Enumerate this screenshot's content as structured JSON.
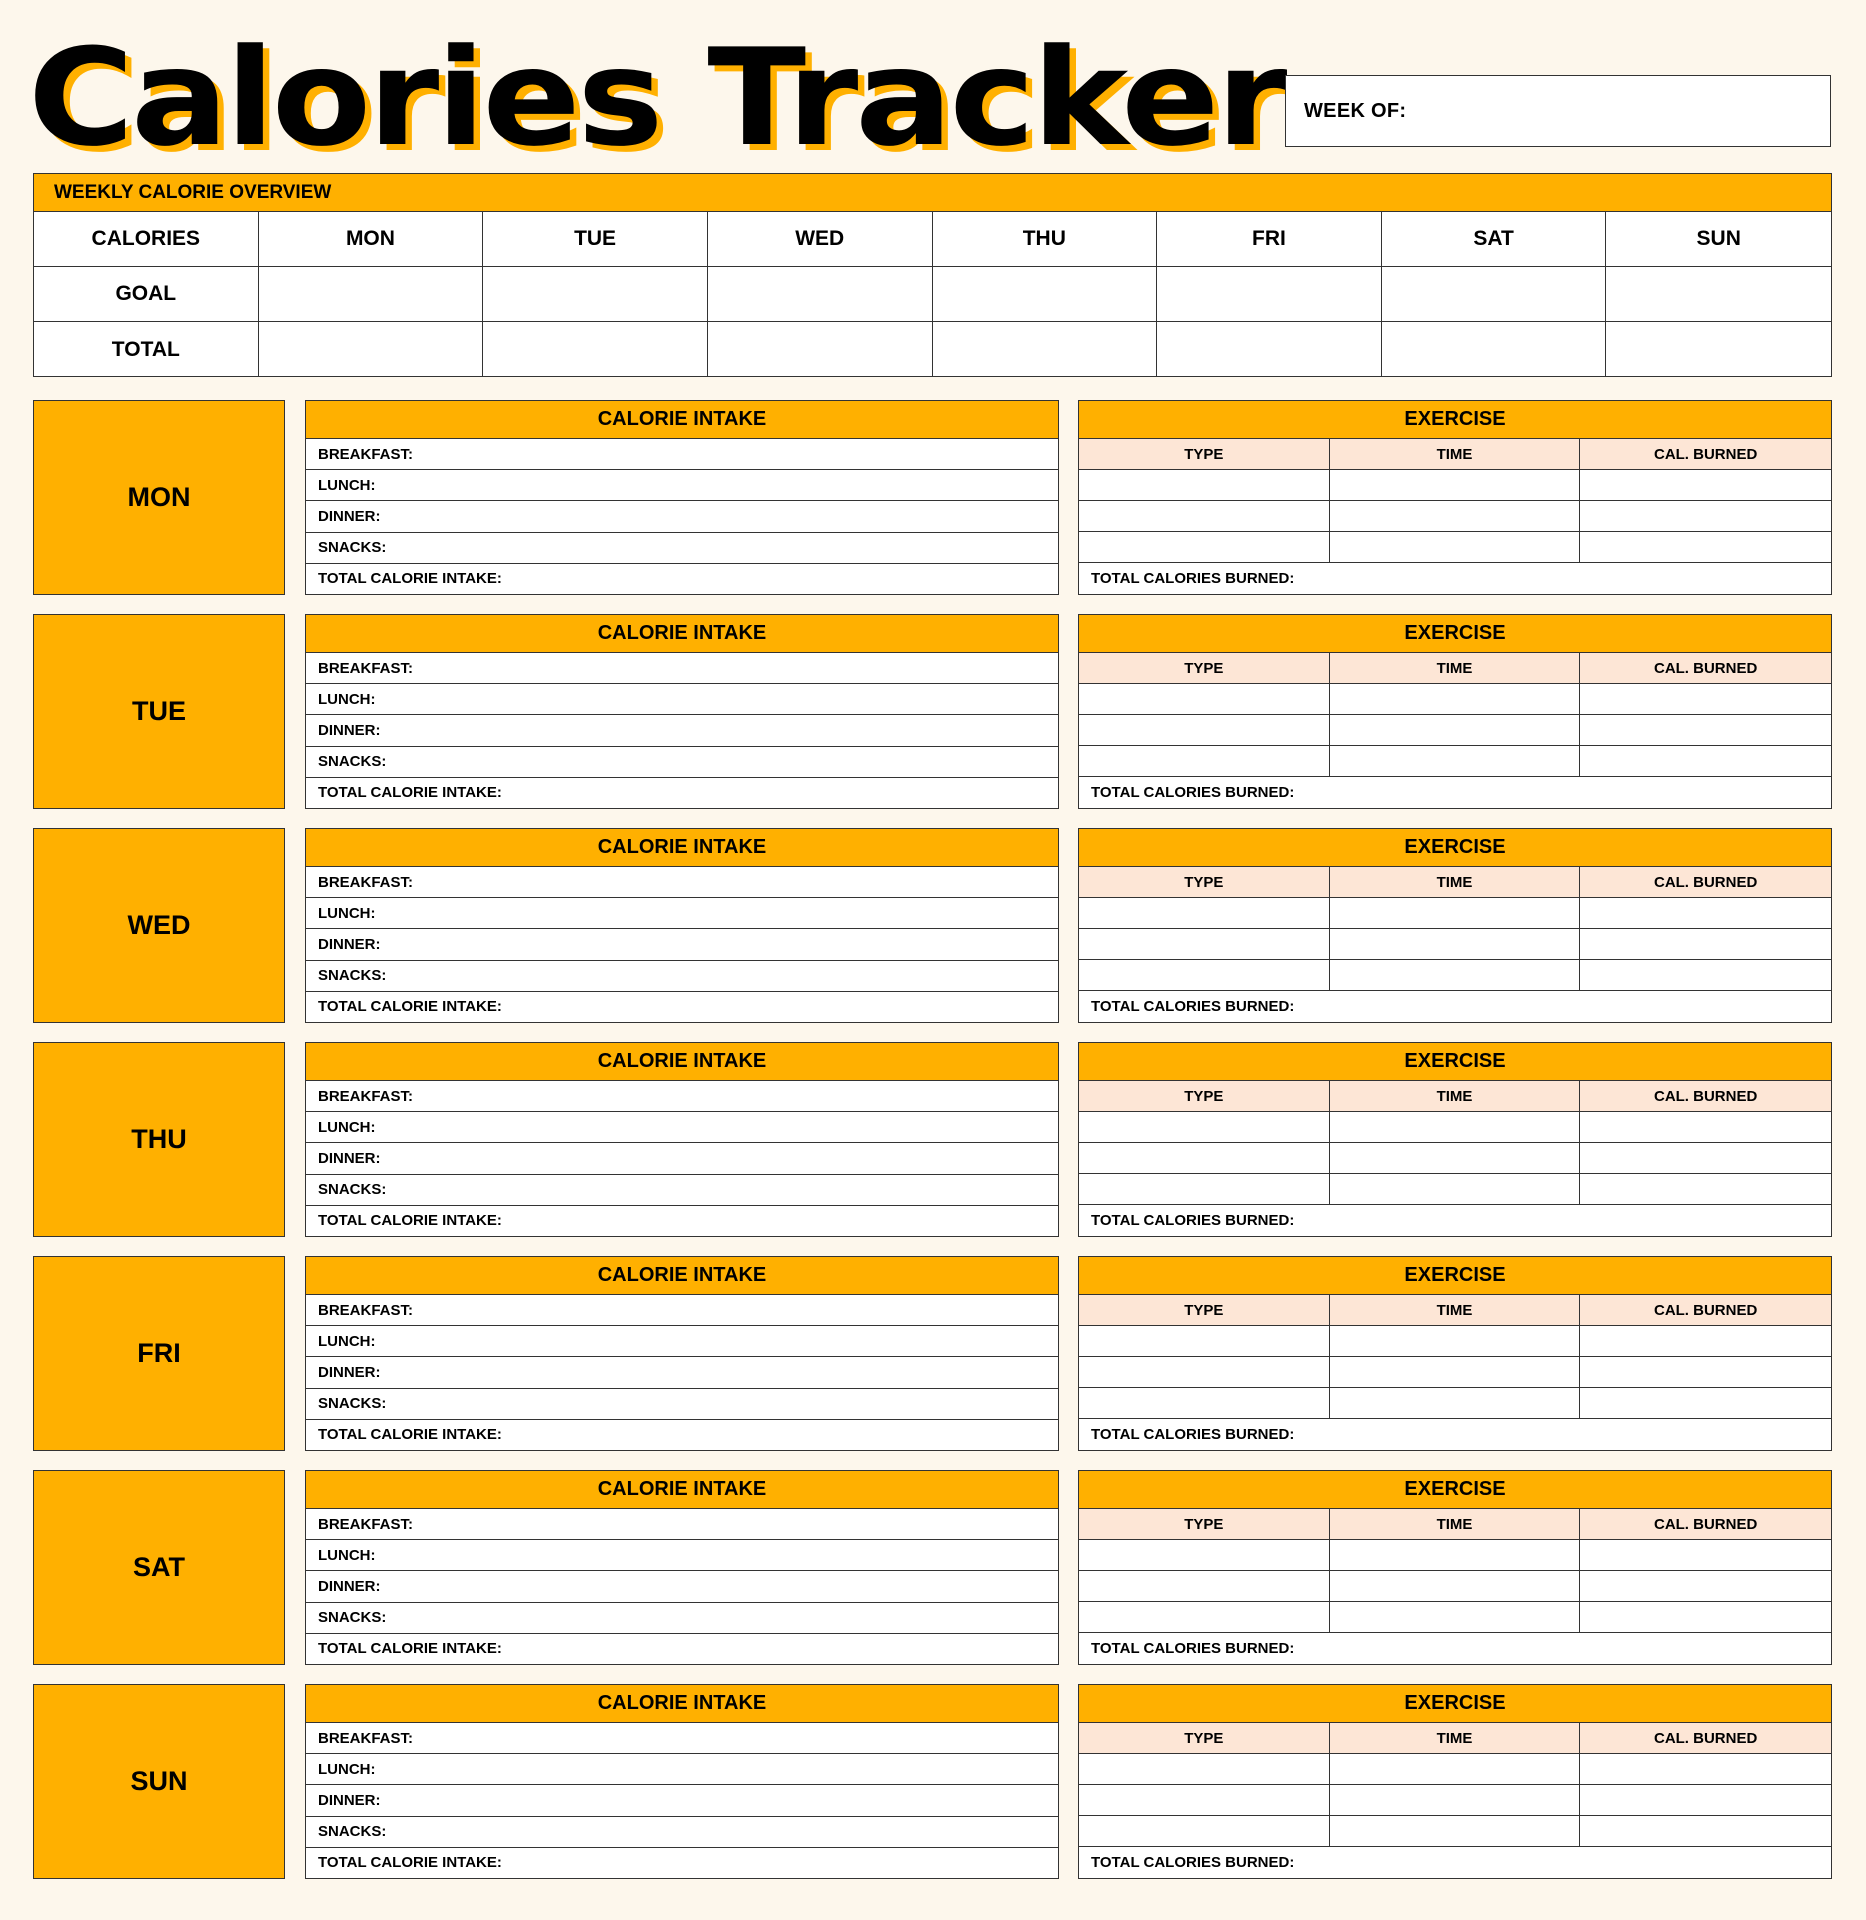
{
  "title": "Calories Tracker",
  "week_of": {
    "label": "WEEK OF:",
    "value": ""
  },
  "colors": {
    "accent": "#FFB000",
    "background": "#FDF7EC",
    "subheader": "#FDE6D6",
    "border": "#333333"
  },
  "overview": {
    "heading": "WEEKLY CALORIE OVERVIEW",
    "columns": [
      "CALORIES",
      "MON",
      "TUE",
      "WED",
      "THU",
      "FRI",
      "SAT",
      "SUN"
    ],
    "rows": [
      {
        "label": "GOAL",
        "values": [
          "",
          "",
          "",
          "",
          "",
          "",
          ""
        ]
      },
      {
        "label": "TOTAL",
        "values": [
          "",
          "",
          "",
          "",
          "",
          "",
          ""
        ]
      }
    ]
  },
  "intake": {
    "heading": "CALORIE INTAKE",
    "fields": [
      "BREAKFAST:",
      "LUNCH:",
      "DINNER:",
      "SNACKS:",
      "TOTAL CALORIE INTAKE:"
    ]
  },
  "exercise": {
    "heading": "EXERCISE",
    "columns": [
      "TYPE",
      "TIME",
      "CAL. BURNED"
    ],
    "blank_rows": 3,
    "total_label": "TOTAL CALORIES BURNED:"
  },
  "days": [
    "MON",
    "TUE",
    "WED",
    "THU",
    "FRI",
    "SAT",
    "SUN"
  ]
}
